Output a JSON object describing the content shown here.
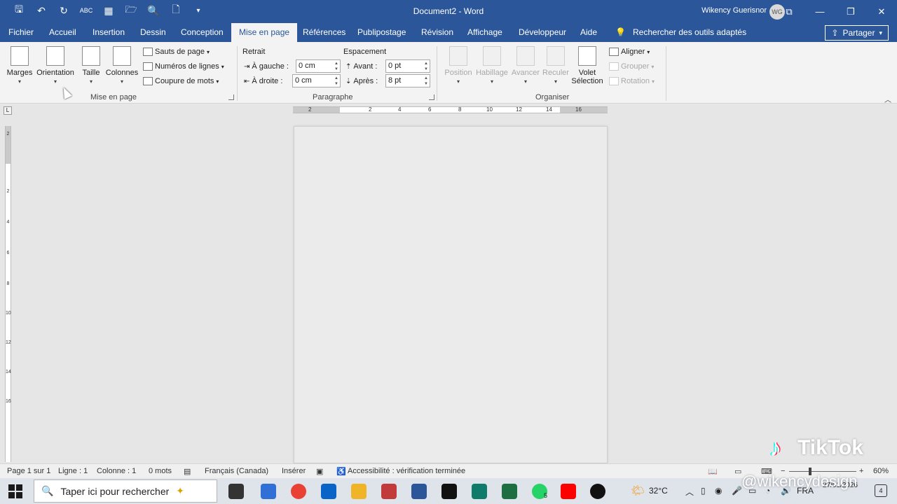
{
  "titlebar": {
    "doc_title": "Document2 - Word",
    "user": "Wikency Guerisnor",
    "initials": "WG"
  },
  "tabs": [
    "Fichier",
    "Accueil",
    "Insertion",
    "Dessin",
    "Conception",
    "Mise en page",
    "Références",
    "Publipostage",
    "Révision",
    "Affichage",
    "Développeur",
    "Aide"
  ],
  "tell_me": "Rechercher des outils adaptés",
  "share_label": "Partager",
  "ribbon": {
    "mise_en_page": {
      "label": "Mise en page",
      "marges": "Marges",
      "orientation": "Orientation",
      "taille": "Taille",
      "colonnes": "Colonnes",
      "sauts": "Sauts de page",
      "numeros": "Numéros de lignes",
      "coupure": "Coupure de mots"
    },
    "paragraphe": {
      "label": "Paragraphe",
      "retrait": "Retrait",
      "espacement": "Espacement",
      "gauche_label": "À gauche :",
      "gauche_value": "0 cm",
      "droite_label": "À droite :",
      "droite_value": "0 cm",
      "avant_label": "Avant :",
      "avant_value": "0 pt",
      "apres_label": "Après :",
      "apres_value": "8 pt"
    },
    "organiser": {
      "label": "Organiser",
      "position": "Position",
      "habillage": "Habillage",
      "avancer": "Avancer",
      "reculer": "Reculer",
      "volet": "Volet",
      "selection": "Sélection",
      "aligner": "Aligner",
      "grouper": "Grouper",
      "rotation": "Rotation"
    }
  },
  "ruler_numbers": [
    "2",
    "2",
    "4",
    "6",
    "8",
    "10",
    "12",
    "14",
    "16"
  ],
  "vruler_numbers": [
    "2",
    "2",
    "4",
    "6",
    "8",
    "10",
    "12",
    "14",
    "16"
  ],
  "status": {
    "page": "Page 1 sur 1",
    "line": "Ligne : 1",
    "column": "Colonne : 1",
    "words": "0 mots",
    "language": "Français (Canada)",
    "mode": "Insérer",
    "accessibility": "Accessibilité : vérification terminée",
    "zoom": "60%"
  },
  "taskbar": {
    "search_placeholder": "Taper ici pour rechercher",
    "temperature": "32°C",
    "lang": "FRA",
    "date": "27/01/2026",
    "notifications": "4",
    "whatsapp_badge": "5"
  },
  "watermark": {
    "brand": "TikTok",
    "handle": "@wikencydesign"
  },
  "colors": {
    "title_bar": "#2b579a",
    "ribbon": "#f3f3f3",
    "canvas": "#e6e6e6"
  }
}
